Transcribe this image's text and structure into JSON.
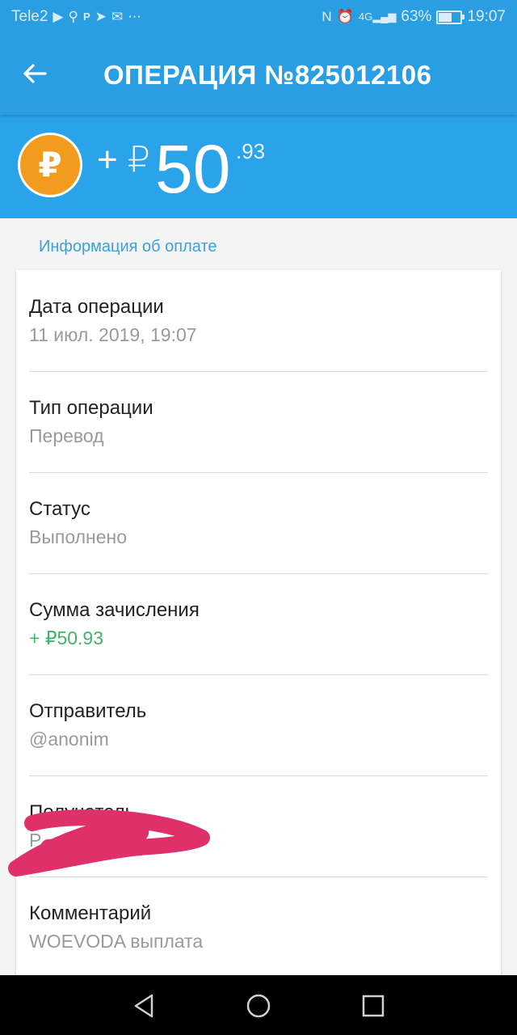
{
  "status_bar": {
    "carrier": "Tele2",
    "network": "4G",
    "battery": "63%",
    "battery_level": 0.63,
    "time": "19:07"
  },
  "app_bar": {
    "title": "ОПЕРАЦИЯ №825012106",
    "back_icon": "arrow-left-icon"
  },
  "hero": {
    "coin_symbol": "₽",
    "sign": "+ ₽",
    "amount": "50",
    "cents": ".93"
  },
  "section_title": "Информация об оплате",
  "details": [
    {
      "label": "Дата операции",
      "value": "11 июл. 2019, 19:07"
    },
    {
      "label": "Тип операции",
      "value": "Перевод"
    },
    {
      "label": "Статус",
      "value": "Выполнено"
    },
    {
      "label": "Сумма зачисления",
      "value": "+ ₽50.93"
    },
    {
      "label": "Отправитель",
      "value": "@anonim"
    },
    {
      "label": "Получатель",
      "value": "Р"
    },
    {
      "label": "Комментарий",
      "value": "WOEVODA выплата"
    }
  ],
  "colors": {
    "primary": "#2a9ee3",
    "accent_coin": "#f39b1f",
    "section_title": "#3aa0de",
    "amount_green": "#3fb66a",
    "scribble": "#e0306a"
  },
  "nav_bar": {
    "icons": [
      "back-triangle-icon",
      "home-circle-icon",
      "recents-square-icon"
    ]
  }
}
